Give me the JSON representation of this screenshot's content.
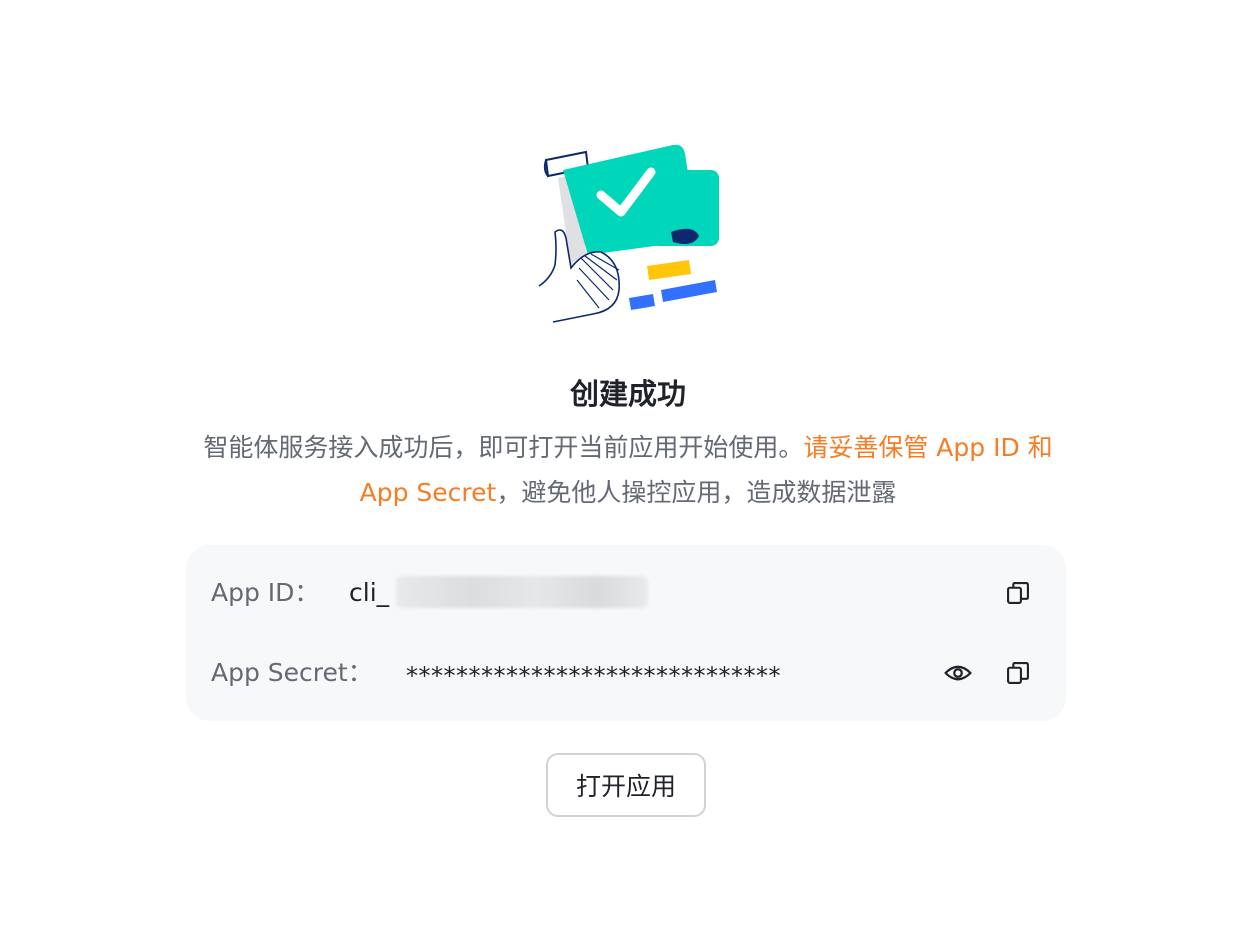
{
  "result": {
    "title": "创建成功",
    "description_prefix": "智能体服务接入成功后，即可打开当前应用开始使用。",
    "description_warning": "请妥善保管 App ID 和 App Secret",
    "description_suffix": "，避免他人操控应用，造成数据泄露"
  },
  "credentials": {
    "app_id_label": "App ID：",
    "app_id_value": "cli_",
    "app_secret_label": "App Secret：",
    "app_secret_value": "******************************"
  },
  "icons": {
    "copy_app_id": "copy-icon",
    "show_secret": "eye-icon",
    "copy_secret": "copy-icon"
  },
  "actions": {
    "open_app_label": "打开应用"
  },
  "colors": {
    "accent_warning": "#f77c23",
    "illustration_primary": "#00d6b9",
    "illustration_yellow": "#ffc60a",
    "illustration_blue": "#3370ff",
    "illustration_navy": "#0c296e"
  }
}
